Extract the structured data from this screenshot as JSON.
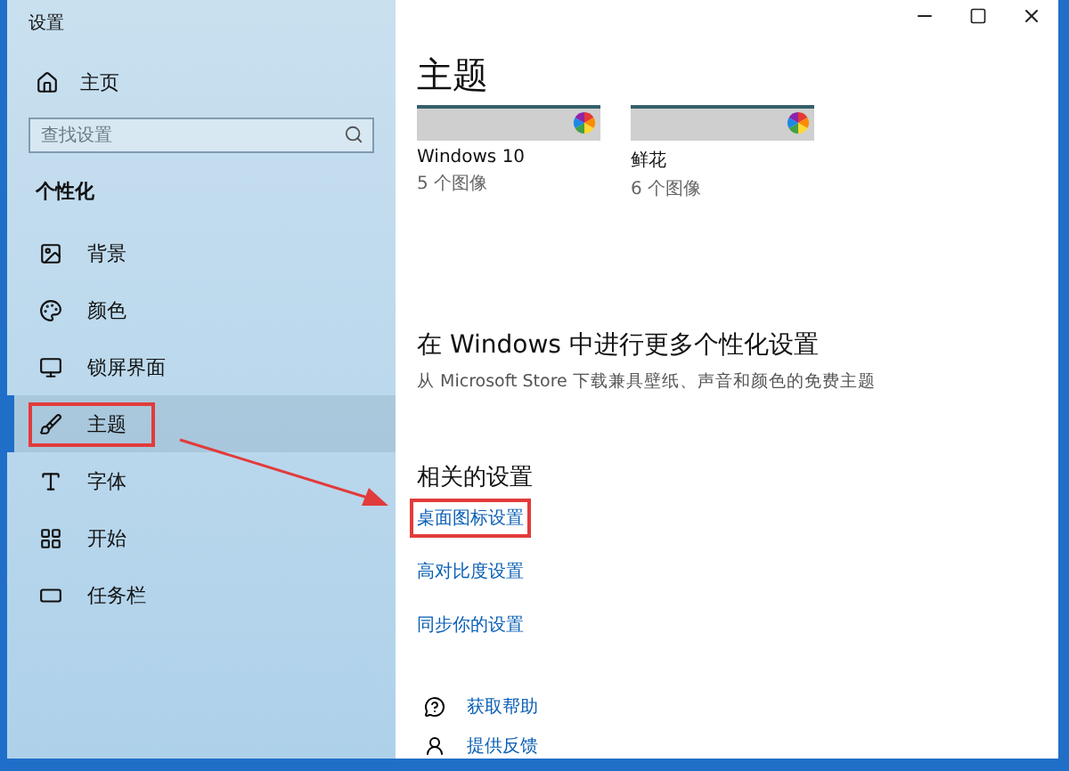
{
  "window": {
    "title": "设置"
  },
  "sidebar": {
    "home": "主页",
    "search": {
      "placeholder": "查找设置"
    },
    "section": "个性化",
    "items": [
      {
        "kind": "background",
        "label": "背景",
        "selected": false,
        "highlighted": false
      },
      {
        "kind": "colors",
        "label": "颜色",
        "selected": false,
        "highlighted": false
      },
      {
        "kind": "lockscreen",
        "label": "锁屏界面",
        "selected": false,
        "highlighted": false
      },
      {
        "kind": "themes",
        "label": "主题",
        "selected": true,
        "highlighted": true
      },
      {
        "kind": "fonts",
        "label": "字体",
        "selected": false,
        "highlighted": false
      },
      {
        "kind": "start",
        "label": "开始",
        "selected": false,
        "highlighted": false
      },
      {
        "kind": "taskbar",
        "label": "任务栏",
        "selected": false,
        "highlighted": false
      }
    ]
  },
  "content": {
    "heading": "主题",
    "themes": [
      {
        "name": "Windows 10",
        "count": "5 个图像"
      },
      {
        "name": "鲜花",
        "count": "6 个图像"
      }
    ],
    "more": {
      "heading": "在 Windows 中进行更多个性化设置",
      "text": "从 Microsoft Store 下载兼具壁纸、声音和颜色的免费主题"
    },
    "related": {
      "heading": "相关的设置",
      "links": [
        {
          "label": "桌面图标设置",
          "highlighted": true
        },
        {
          "label": "高对比度设置",
          "highlighted": false
        },
        {
          "label": "同步你的设置",
          "highlighted": false
        }
      ]
    },
    "help": [
      {
        "kind": "help",
        "label": "获取帮助"
      },
      {
        "kind": "feedback",
        "label": "提供反馈"
      }
    ]
  }
}
